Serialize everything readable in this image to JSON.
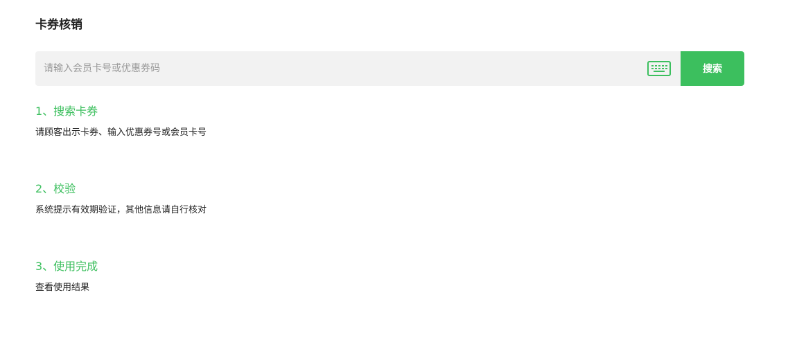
{
  "page": {
    "title": "卡券核销"
  },
  "search": {
    "placeholder": "请输入会员卡号或优惠券码",
    "value": "",
    "button_label": "搜索",
    "keyboard_icon": "keyboard-icon",
    "accent_color": "#3cbf5e"
  },
  "steps": [
    {
      "title": "1、搜索卡券",
      "description": "请顾客出示卡券、输入优惠券号或会员卡号"
    },
    {
      "title": "2、校验",
      "description": "系统提示有效期验证，其他信息请自行核对"
    },
    {
      "title": "3、使用完成",
      "description": "查看使用结果"
    }
  ]
}
